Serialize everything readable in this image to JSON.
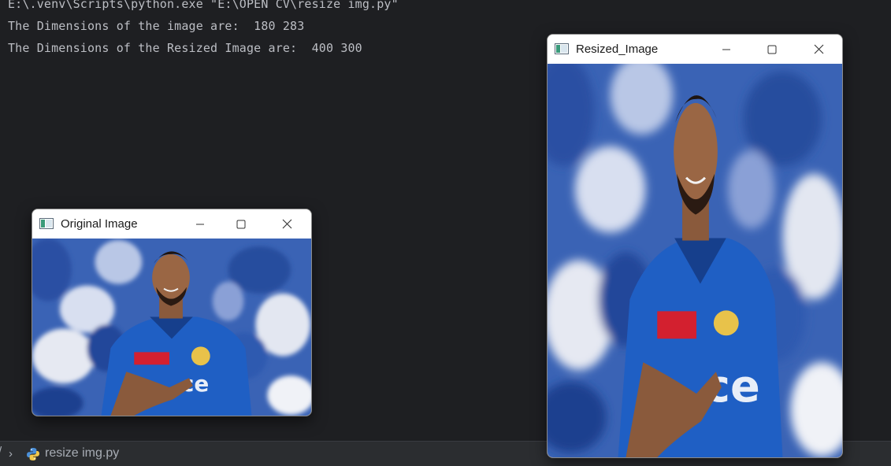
{
  "terminal": {
    "lines": [
      "E:\\.venv\\Scripts\\python.exe \"E:\\OPEN CV\\resize img.py\"",
      "The Dimensions of the image are:  180 283",
      "The Dimensions of the Resized Image are:  400 300"
    ]
  },
  "statusbar": {
    "file_name": "resize img.py",
    "chevron": "›",
    "clipped_glyph": "/"
  },
  "windows": {
    "original": {
      "title": "Original Image"
    },
    "resized": {
      "title": "Resized_Image"
    }
  },
  "colors": {
    "terminal_bg": "#1e1f22",
    "terminal_text": "#bcbec4",
    "statusbar_bg": "#2b2d30",
    "jersey_blue": "#1f5fc4",
    "crowd_blue": "#2f5fb8"
  },
  "icons": {
    "minimize": "minimize-icon",
    "maximize": "maximize-icon",
    "close": "close-icon",
    "app": "opencv-window-icon",
    "python": "python-file-icon"
  }
}
